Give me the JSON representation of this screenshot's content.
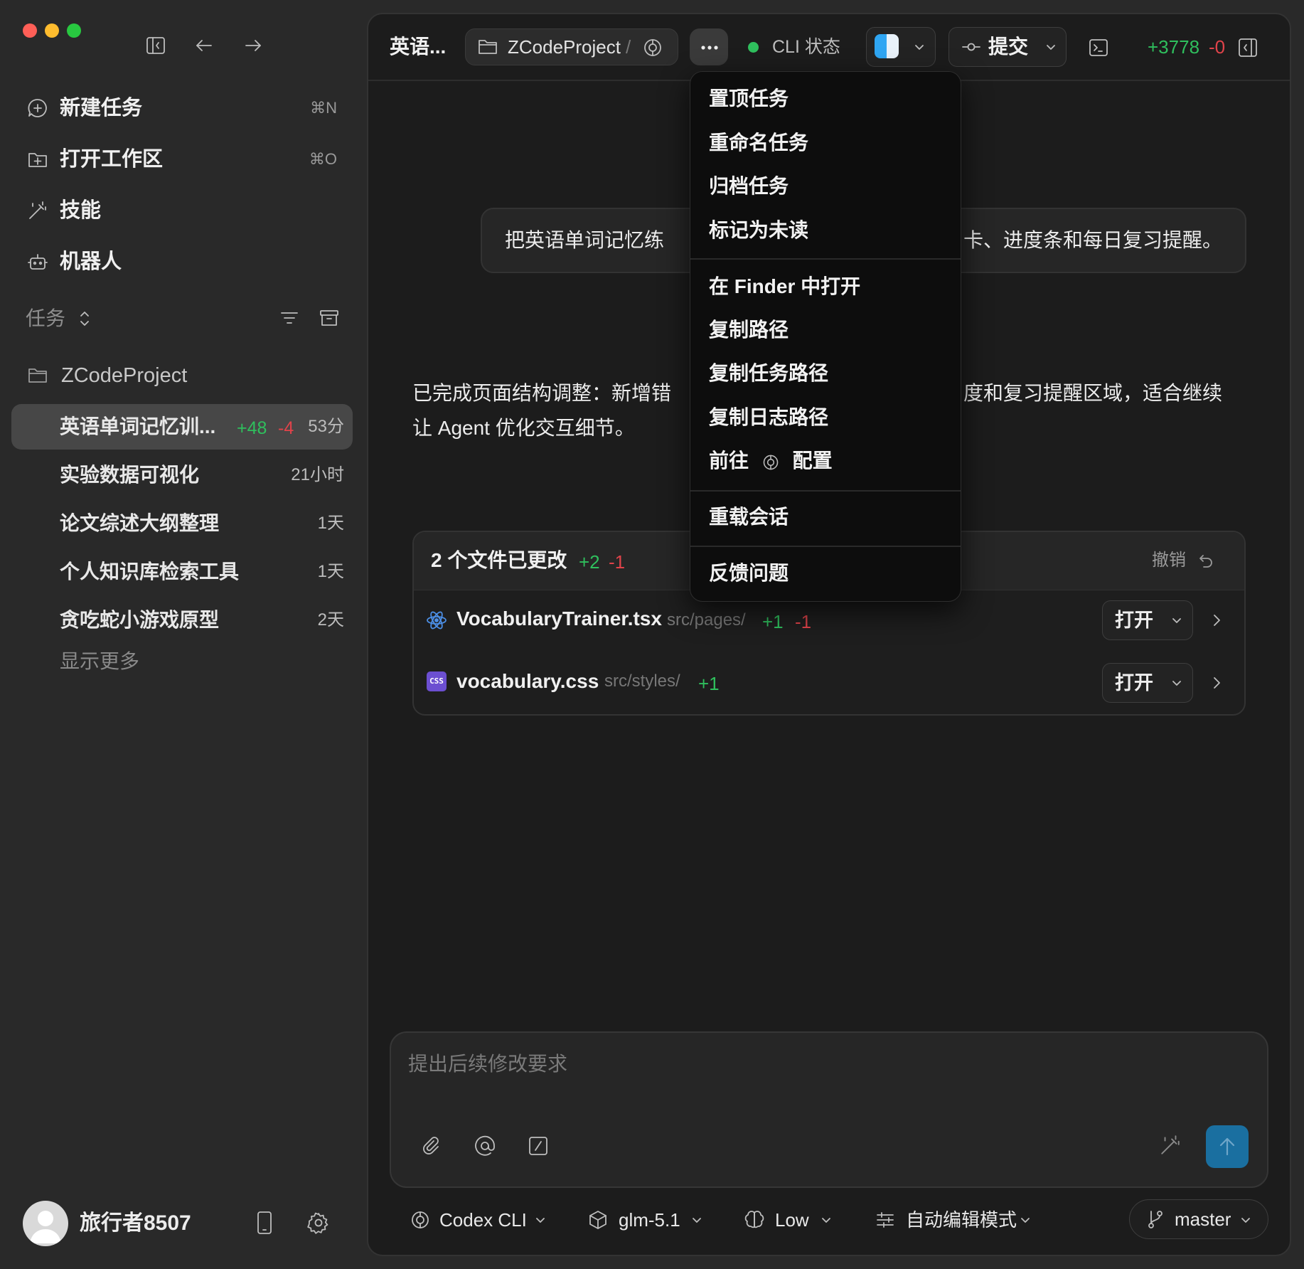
{
  "window": {
    "traffic_lights": {
      "close": "#ff5f57",
      "minimize": "#febc2e",
      "maximize": "#28c840"
    }
  },
  "sidebar": {
    "nav": [
      {
        "label": "新建任务",
        "shortcut": "⌘N",
        "icon": "new-chat-icon"
      },
      {
        "label": "打开工作区",
        "shortcut": "⌘O",
        "icon": "folder-plus-icon"
      },
      {
        "label": "技能",
        "shortcut": "",
        "icon": "magic-wand-icon"
      },
      {
        "label": "机器人",
        "shortcut": "",
        "icon": "robot-icon"
      }
    ],
    "tasks_header": "任务",
    "project": "ZCodeProject",
    "tasks": [
      {
        "title": "英语单词记忆训...",
        "added": "+48",
        "removed": "-4",
        "time": "53分",
        "active": true
      },
      {
        "title": "实验数据可视化",
        "time": "21小时"
      },
      {
        "title": "论文综述大纲整理",
        "time": "1天"
      },
      {
        "title": "个人知识库检索工具",
        "time": "1天"
      },
      {
        "title": "贪吃蛇小游戏原型",
        "time": "2天"
      }
    ],
    "show_more": "显示更多",
    "user": {
      "name": "旅行者8507"
    }
  },
  "header": {
    "title": "英语...",
    "project": "ZCodeProject",
    "separator": "/",
    "cli_status": "CLI 状态",
    "commit": "提交",
    "added": "+3778",
    "removed": "-0",
    "status_color": "#2fbf5d"
  },
  "chat": {
    "user_message_left": "把英语单词记忆练",
    "user_message_right": "卡、进度条和每日复习提醒。",
    "assistant_line1_left": "已完成页面结构调整：新增错",
    "assistant_line1_right": "度和复习提醒区域，适合继续",
    "assistant_line2": "让 Agent 优化交互细节。"
  },
  "changes": {
    "title": "2 个文件已更改",
    "added": "+2",
    "removed": "-1",
    "undo": "撤销",
    "files": [
      {
        "name": "VocabularyTrainer.tsx",
        "path": "src/pages/",
        "added": "+1",
        "removed": "-1",
        "action": "打开",
        "icon": "react-icon"
      },
      {
        "name": "vocabulary.css",
        "path": "src/styles/",
        "added": "+1",
        "removed": "",
        "action": "打开",
        "icon": "css-icon"
      }
    ]
  },
  "menu": {
    "items": [
      "置顶任务",
      "重命名任务",
      "归档任务",
      "标记为未读",
      "在 Finder 中打开",
      "复制路径",
      "复制任务路径",
      "复制日志路径"
    ],
    "goto_prefix": "前往",
    "goto_suffix": "配置",
    "reload": "重载会话",
    "feedback": "反馈问题"
  },
  "composer": {
    "placeholder": "提出后续修改要求",
    "send_color": "#1a6fa0"
  },
  "footer": {
    "agent": "Codex CLI",
    "model": "glm-5.1",
    "effort": "Low",
    "mode": "自动编辑模式",
    "branch": "master"
  }
}
